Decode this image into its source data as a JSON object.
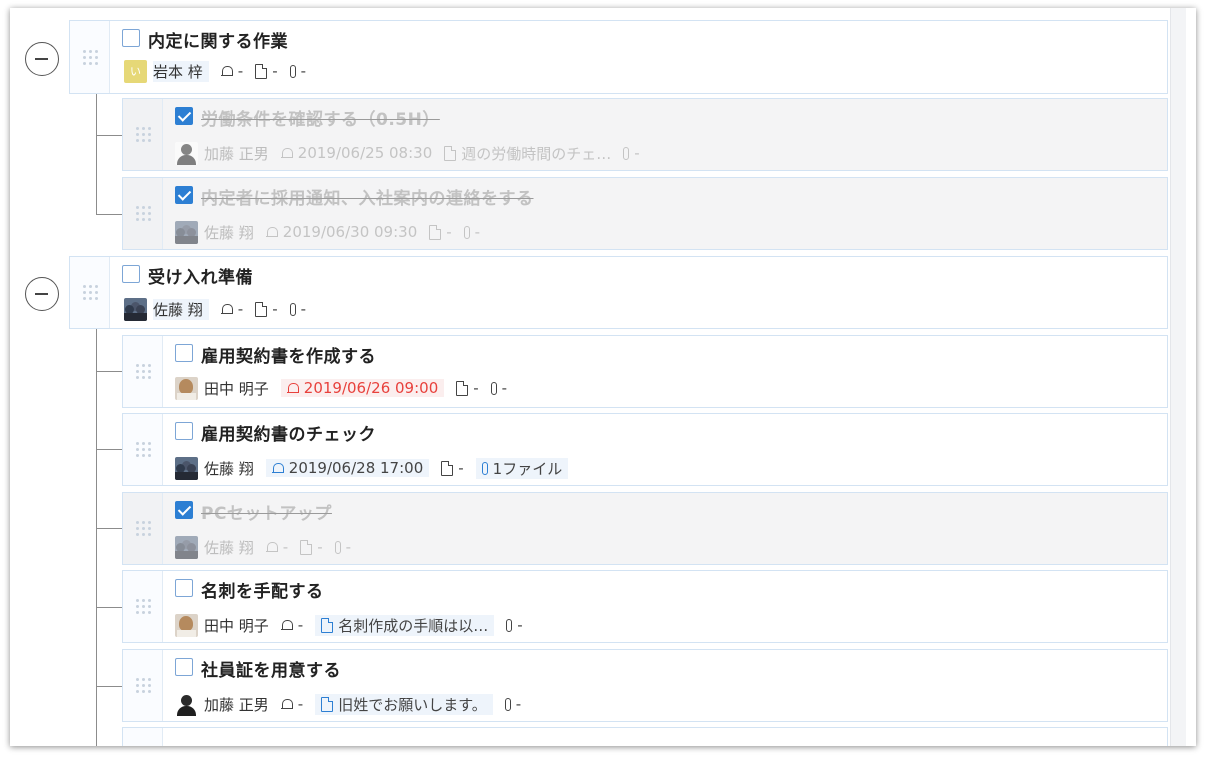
{
  "groups": [
    {
      "title": "内定に関する作業",
      "assignee": "岩本 梓",
      "avatar_initial": "い",
      "reminder": "-",
      "memo": "-",
      "files": "-",
      "children": [
        {
          "title": "労働条件を確認する（0.5H）",
          "done": true,
          "assignee": "加藤 正男",
          "reminder": "2019/06/25 08:30",
          "memo": "週の労働時間のチェ…",
          "files": "-"
        },
        {
          "title": "内定者に採用通知、入社案内の連絡をする",
          "done": true,
          "assignee": "佐藤 翔",
          "reminder": "2019/06/30 09:30",
          "memo": "-",
          "files": "-"
        }
      ]
    },
    {
      "title": "受け入れ準備",
      "assignee": "佐藤 翔",
      "reminder": "-",
      "memo": "-",
      "files": "-",
      "children": [
        {
          "title": "雇用契約書を作成する",
          "done": false,
          "assignee": "田中 明子",
          "reminder": "2019/06/26 09:00",
          "reminder_overdue": true,
          "memo": "-",
          "files": "-"
        },
        {
          "title": "雇用契約書のチェック",
          "done": false,
          "assignee": "佐藤 翔",
          "reminder": "2019/06/28 17:00",
          "memo": "-",
          "files": "1ファイル"
        },
        {
          "title": "PCセットアップ",
          "done": true,
          "assignee": "佐藤 翔",
          "reminder": "-",
          "memo": "-",
          "files": "-"
        },
        {
          "title": "名刺を手配する",
          "done": false,
          "assignee": "田中 明子",
          "reminder": "-",
          "memo": "名刺作成の手順は以…",
          "files": "-"
        },
        {
          "title": "社員証を用意する",
          "done": false,
          "assignee": "加藤 正男",
          "reminder": "-",
          "memo": "旧姓でお願いします。",
          "files": "-"
        }
      ]
    }
  ],
  "colors": {
    "accent": "#2d7fd3",
    "overdue": "#e8413c",
    "card_border": "#d3e3f3",
    "done_bg": "#f4f4f5"
  },
  "icons": {
    "reminder": "bell-icon",
    "memo": "document-icon",
    "files": "paperclip-icon",
    "drag": "drag-handle-icon",
    "collapse": "collapse-minus-icon"
  }
}
